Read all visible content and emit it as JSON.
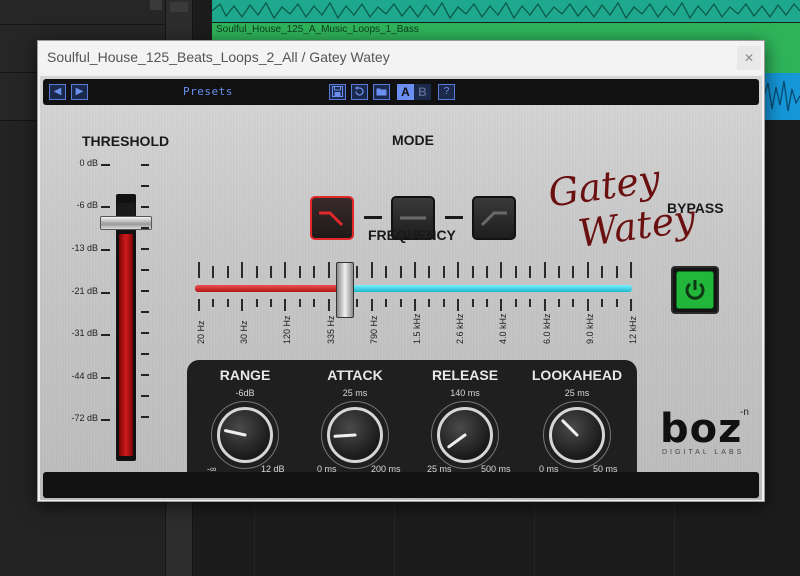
{
  "daw": {
    "clip_label": "Soulful_House_125_A_Music_Loops_1_Bass"
  },
  "window": {
    "title": "Soulful_House_125_Beats_Loops_2_All / Gatey Watey",
    "close_label": "✕"
  },
  "toolbar": {
    "prev_label": "◀",
    "next_label": "▶",
    "presets_label": "Presets",
    "a_label": "A",
    "b_label": "B",
    "help_label": "?"
  },
  "threshold": {
    "title": "THRESHOLD",
    "scale": [
      "0 dB",
      "-6 dB",
      "-13 dB",
      "-21 dB",
      "-31 dB",
      "-44 dB",
      "-72 dB"
    ],
    "value_fraction": 0.0
  },
  "mode": {
    "title": "MODE",
    "options": [
      "high-cut",
      "flat",
      "low-cut"
    ],
    "selected": "high-cut"
  },
  "signature": {
    "line1": "Gatey",
    "line2": "Watey"
  },
  "bypass": {
    "title": "BYPASS",
    "state": "on"
  },
  "frequency": {
    "title": "FREQUENCY",
    "scale": [
      "20 Hz",
      "30 Hz",
      "120 Hz",
      "335 Hz",
      "790 Hz",
      "1.5 kHz",
      "2.6 kHz",
      "4.0 kHz",
      "6.0 kHz",
      "9.0 kHz",
      "12 kHz"
    ],
    "value": "335 Hz"
  },
  "knobs": [
    {
      "title": "RANGE",
      "value": "-6dB",
      "min": "-∞",
      "max": "12 dB",
      "fraction": 0.12
    },
    {
      "title": "ATTACK",
      "value": "25 ms",
      "min": "0 ms",
      "max": "200 ms",
      "fraction": 0.18
    },
    {
      "title": "RELEASE",
      "value": "140 ms",
      "min": "25 ms",
      "max": "500 ms",
      "fraction": 0.3
    },
    {
      "title": "LOOKAHEAD",
      "value": "25 ms",
      "min": "0 ms",
      "max": "50 ms",
      "fraction": 0.0
    }
  ],
  "logo": {
    "brand": "boz",
    "sup": "-n",
    "sub": "DIGITAL LABS"
  }
}
